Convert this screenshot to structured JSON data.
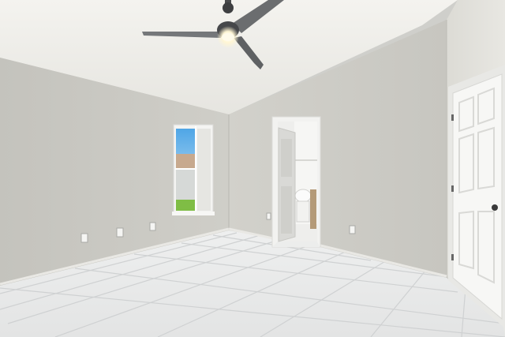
{
  "scene": {
    "description_free": true,
    "palette": {
      "ceiling": "#f1f0ec",
      "wall_left": "#c9c8c2",
      "wall_back": "#cccbc5",
      "wall_right": "#e3e2dc",
      "floor_tile": "#e9eaea",
      "grout": "#c9cbcc",
      "trim": "#f4f4f2",
      "door": "#f7f7f5",
      "fan_blade": "#6b6d6f",
      "fan_light": "#fff8dc",
      "sky": "#8cc6ee",
      "grass": "#7fbd45"
    },
    "icons": {
      "ceiling_fan": "ceiling-fan-icon",
      "window": "window-icon",
      "doorway": "bathroom-doorway-icon",
      "door": "closet-door-icon",
      "outlet": "outlet-icon"
    }
  }
}
